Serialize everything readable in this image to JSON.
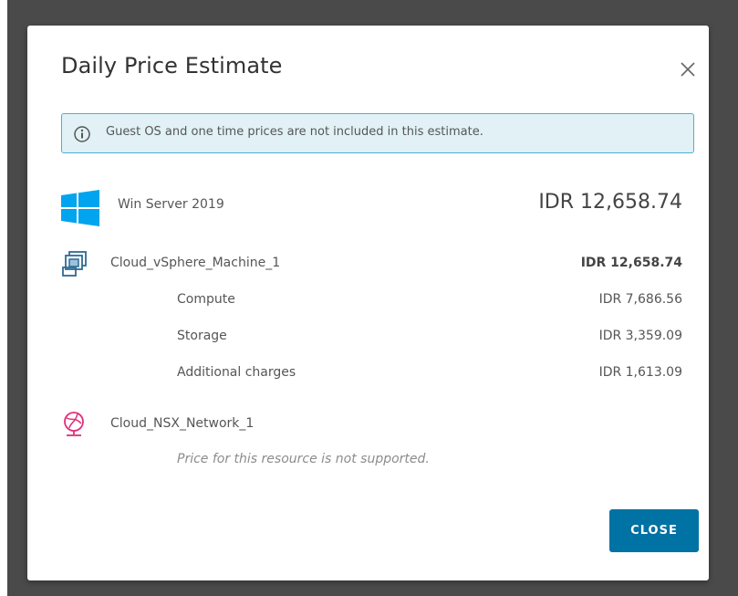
{
  "dialog": {
    "title": "Daily Price Estimate",
    "close_icon": "close-icon",
    "alert": {
      "icon": "info-icon",
      "text": "Guest OS and one time prices are not included in this estimate."
    },
    "items": {
      "os": {
        "icon": "windows-logo-icon",
        "label": "Win Server 2019",
        "price": "IDR 12,658.74"
      },
      "machine": {
        "icon": "vsphere-machine-icon",
        "label": "Cloud_vSphere_Machine_1",
        "price": "IDR 12,658.74",
        "breakdown": [
          {
            "label": "Compute",
            "price": "IDR 7,686.56"
          },
          {
            "label": "Storage",
            "price": "IDR 3,359.09"
          },
          {
            "label": "Additional charges",
            "price": "IDR 1,613.09"
          }
        ]
      },
      "network": {
        "icon": "nsx-network-icon",
        "label": "Cloud_NSX_Network_1",
        "note": "Price for this resource is not supported."
      }
    },
    "close_button_label": "CLOSE"
  },
  "colors": {
    "accent": "#0072a3",
    "alert_border": "#49afd9",
    "alert_bg": "#e1f1f6",
    "windows_blue": "#00a4ef",
    "network_pink": "#e0307a"
  }
}
